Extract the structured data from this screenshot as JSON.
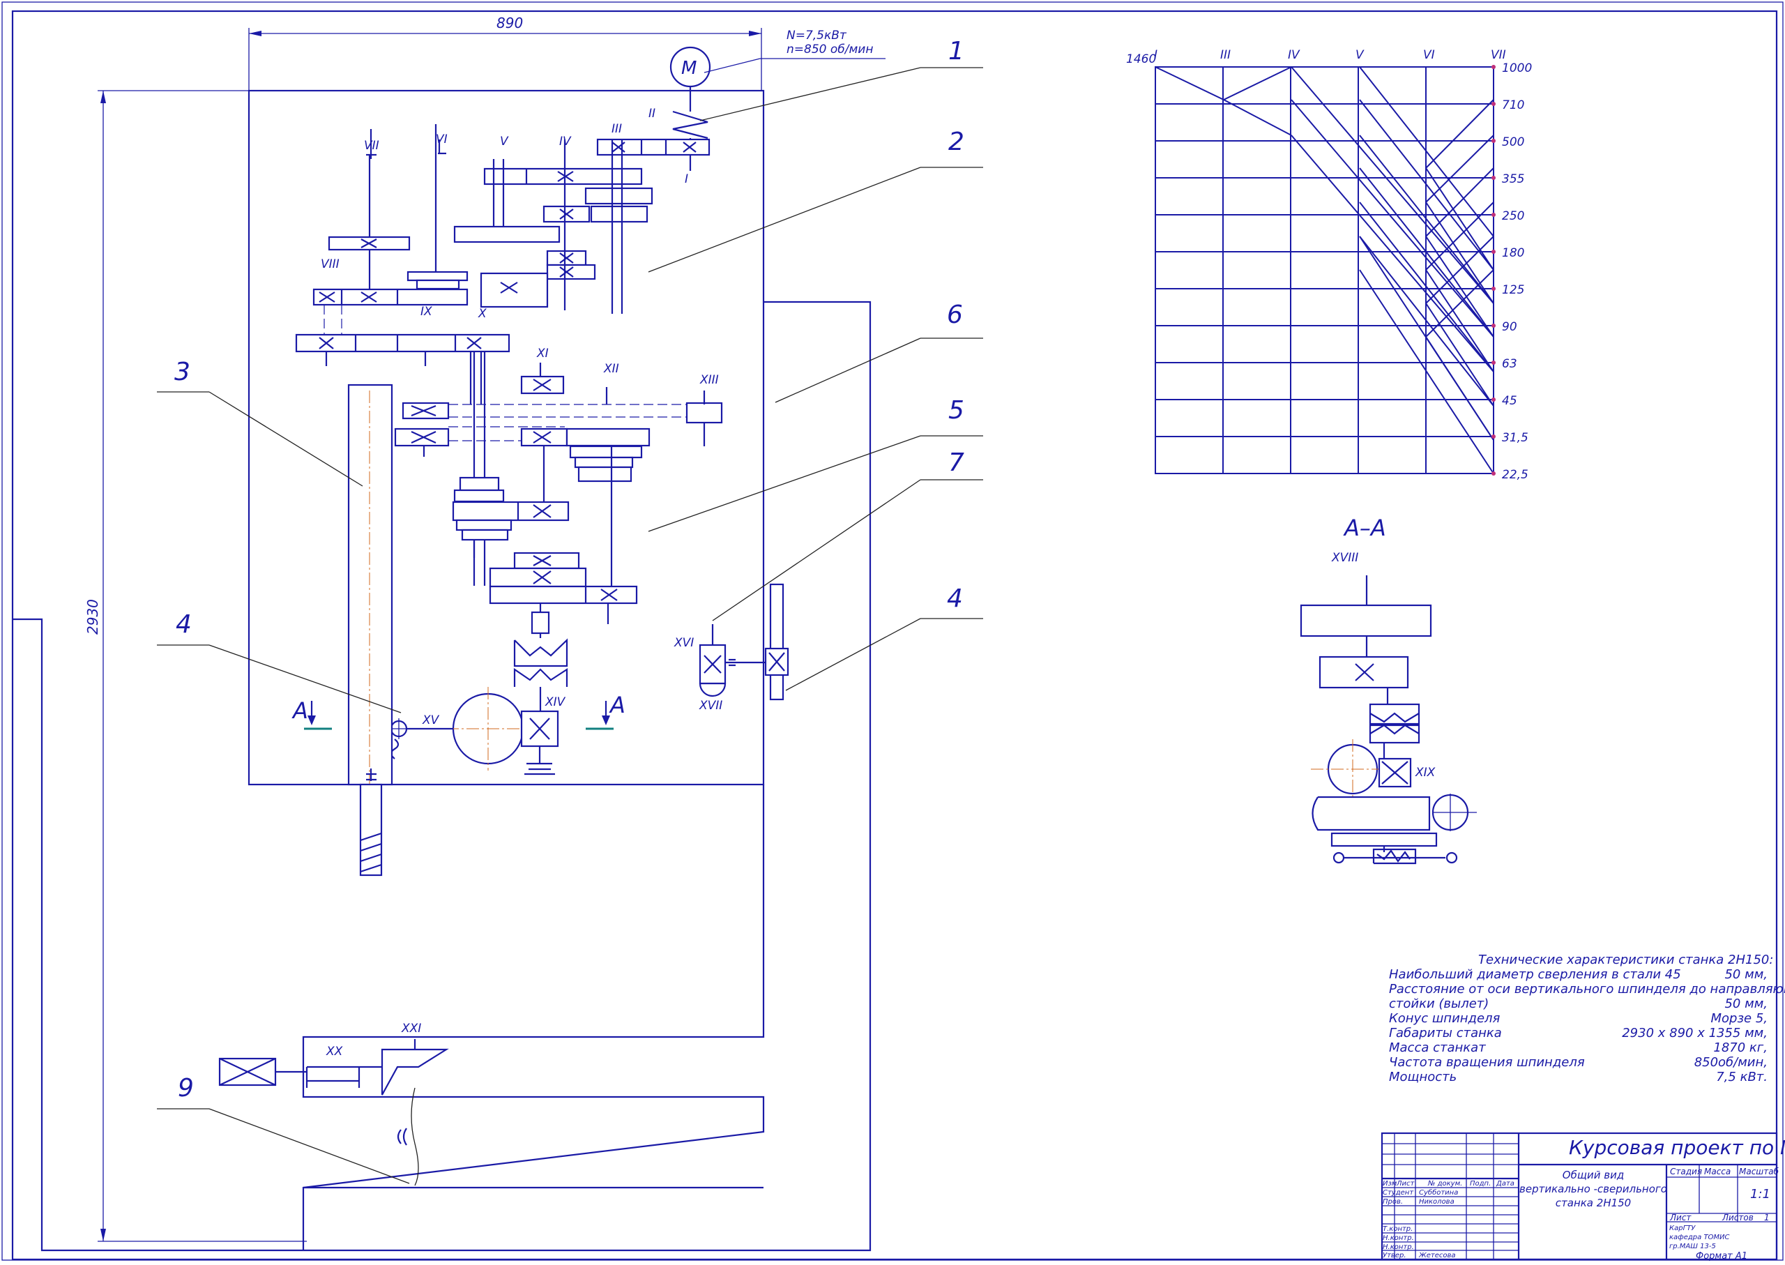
{
  "drawing": {
    "dim_width": "890",
    "dim_height": "2930",
    "motor_label": "M",
    "motor_power": "N=7,5кВт",
    "motor_speed": "n=850 об/мин",
    "section_arrow_label": "A",
    "callouts": [
      "1",
      "2",
      "6",
      "3",
      "5",
      "7",
      "4",
      "4",
      "9"
    ],
    "shafts": [
      "I",
      "II",
      "III",
      "IV",
      "V",
      "VI",
      "VII",
      "VIII",
      "IX",
      "X",
      "XI",
      "XII",
      "XIII",
      "XIV",
      "XV",
      "XVI",
      "XVII",
      "XX",
      "XXI"
    ]
  },
  "speed_chart": {
    "input_speed": "1460",
    "shafts": [
      "I",
      "III",
      "IV",
      "V",
      "VI",
      "VII"
    ],
    "speeds": [
      "1000",
      "710",
      "500",
      "355",
      "250",
      "180",
      "125",
      "90",
      "63",
      "45",
      "31,5",
      "22,5"
    ]
  },
  "section": {
    "title": "А–А",
    "shafts": [
      "XVIII",
      "XIX"
    ]
  },
  "specs": {
    "title": "Технические характеристики станка 2Н150:",
    "rows": [
      {
        "label": "Наибольший диаметр сверления в стали 45",
        "value": "50 мм,"
      },
      {
        "label": "Расстояние от оси вертикального шпинделя до направляющих",
        "value": ""
      },
      {
        "label": "стойки (вылет)",
        "value": "50 мм,"
      },
      {
        "label": "Конус шпинделя",
        "value": "Морзе 5,"
      },
      {
        "label": "Габариты станка",
        "value": "2930 х 890 х 1355 мм,"
      },
      {
        "label": "Масса станкат",
        "value": "1870 кг,"
      },
      {
        "label": "Частота вращения шпинделя",
        "value": "850об/мин,"
      },
      {
        "label": "Мощность",
        "value": "7,5 кВт."
      }
    ]
  },
  "title_block": {
    "project": "Курсовая проект по МРС",
    "drawing_title": [
      "Общий вид",
      "вертикально -сверильного",
      "станка 2Н150"
    ],
    "col_headers": [
      "Изм",
      "Лист",
      "№ докум.",
      "Подп.",
      "Дата"
    ],
    "roles": [
      "Студент",
      "Пров.",
      "Т.контр.",
      "Н.контр.",
      "Н.контр.",
      "Утвер."
    ],
    "names": [
      "Субботина",
      "Николова",
      "",
      "",
      "",
      "Жетесова"
    ],
    "stage_headers": [
      "Стадия",
      "Масса",
      "Масштаб"
    ],
    "scale": "1:1",
    "sheet_label": "Лист",
    "sheets_label": "Листов",
    "sheets_count": "1",
    "org": [
      "КарГТУ",
      "кафедра ТОМИС",
      "гр.МАШ 13-5"
    ],
    "format": "Формат    А1"
  }
}
